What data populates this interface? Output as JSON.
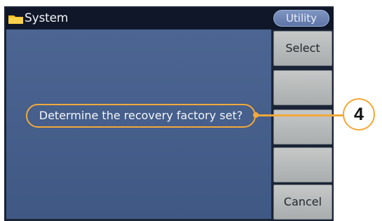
{
  "header": {
    "title": "System",
    "folder_icon": "folder-icon",
    "tab_label": "Utility"
  },
  "softkeys": [
    {
      "label": "Select"
    },
    {
      "label": ""
    },
    {
      "label": ""
    },
    {
      "label": ""
    },
    {
      "label": "Cancel"
    }
  ],
  "dialog": {
    "message": "Determine the recovery factory set?"
  },
  "callout": {
    "number": "4"
  },
  "colors": {
    "accent": "#f2a93b",
    "panel": "#46608c",
    "titlebar": "#0f1728",
    "softkey": "#b8bcbc"
  }
}
